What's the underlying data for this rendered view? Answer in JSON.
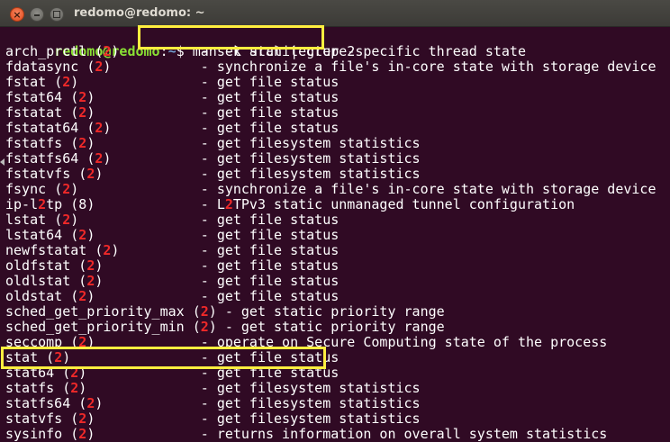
{
  "window": {
    "title": "redomo@redomo: ~",
    "buttons": {
      "close": "×"
    }
  },
  "terminal": {
    "prompt": {
      "user_host": "redomo@redomo",
      "separator": ":",
      "path": "~",
      "symbol": "$ "
    },
    "command": "man -k stat | grep 2",
    "lines": [
      {
        "name": "arch_prctl",
        "gap": " ",
        "section": "2",
        "desc": "set architecture-specific thread state"
      },
      {
        "name": "fdatasync",
        "gap": " ",
        "section": "2",
        "desc": "synchronize a file's in-core state with storage device"
      },
      {
        "name": "fstat",
        "gap": " ",
        "section": "2",
        "desc": "get file status"
      },
      {
        "name": "fstat64",
        "gap": " ",
        "section": "2",
        "desc": "get file status"
      },
      {
        "name": "fstatat",
        "gap": " ",
        "section": "2",
        "desc": "get file status"
      },
      {
        "name": "fstatat64",
        "gap": " ",
        "section": "2",
        "desc": "get file status"
      },
      {
        "name": "fstatfs",
        "gap": " ",
        "section": "2",
        "desc": "get filesystem statistics"
      },
      {
        "name": "fstatfs64",
        "gap": " ",
        "section": "2",
        "desc": "get filesystem statistics"
      },
      {
        "name": "fstatvfs",
        "gap": " ",
        "section": "2",
        "desc": "get filesystem statistics"
      },
      {
        "name": "fsync",
        "gap": " ",
        "section": "2",
        "desc": "synchronize a file's in-core state with storage device"
      },
      {
        "name": "ip-l2tp",
        "gap": " ",
        "section": "8",
        "desc": "L2TPv3 static unmanaged tunnel configuration",
        "name_hl": [
          4,
          5
        ],
        "desc_hl": [
          1,
          2
        ]
      },
      {
        "name": "lstat",
        "gap": " ",
        "section": "2",
        "desc": "get file status"
      },
      {
        "name": "lstat64",
        "gap": " ",
        "section": "2",
        "desc": "get file status"
      },
      {
        "name": "newfstatat",
        "gap": " ",
        "section": "2",
        "desc": "get file status"
      },
      {
        "name": "oldfstat",
        "gap": " ",
        "section": "2",
        "desc": "get file status"
      },
      {
        "name": "oldlstat",
        "gap": " ",
        "section": "2",
        "desc": "get file status"
      },
      {
        "name": "oldstat",
        "gap": " ",
        "section": "2",
        "desc": "get file status"
      },
      {
        "name": "sched_get_priority_max",
        "gap": " ",
        "section": "2",
        "desc": "get static priority range"
      },
      {
        "name": "sched_get_priority_min",
        "gap": " ",
        "section": "2",
        "desc": "get static priority range"
      },
      {
        "name": "seccomp",
        "gap": " ",
        "section": "2",
        "desc": "operate on Secure Computing state of the process"
      },
      {
        "name": "stat",
        "gap": " ",
        "section": "2",
        "desc": "get file status"
      },
      {
        "name": "stat64",
        "gap": " ",
        "section": "2",
        "desc": "get file status"
      },
      {
        "name": "statfs",
        "gap": " ",
        "section": "2",
        "desc": "get filesystem statistics"
      },
      {
        "name": "statfs64",
        "gap": " ",
        "section": "2",
        "desc": "get filesystem statistics"
      },
      {
        "name": "statvfs",
        "gap": " ",
        "section": "2",
        "desc": "get filesystem statistics"
      },
      {
        "name": "sysinfo",
        "gap": " ",
        "section": "2",
        "desc": "returns information on overall system statistics"
      }
    ],
    "highlighted_command": "man -k stat | grep 2",
    "highlighted_line": "stat (2)"
  },
  "colors": {
    "background": "#300a24",
    "text": "#ffffff",
    "prompt_user": "#8ae234",
    "prompt_path": "#729fcf",
    "match": "#ef2929",
    "annotation_box": "#ffee3f"
  }
}
